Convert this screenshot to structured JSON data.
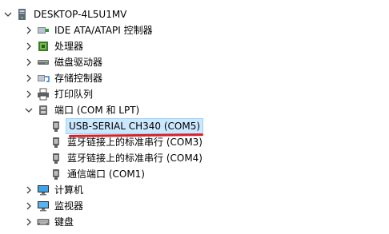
{
  "device_manager": {
    "root": {
      "label": "DESKTOP-4L5U1MV",
      "expanded": true,
      "icon": "computer-icon"
    },
    "items": [
      {
        "label": "IDE ATA/ATAPI 控制器",
        "expanded": false,
        "icon": "controller-icon"
      },
      {
        "label": "处理器",
        "expanded": false,
        "icon": "processor-icon"
      },
      {
        "label": "磁盘驱动器",
        "expanded": false,
        "icon": "disk-drive-icon"
      },
      {
        "label": "存储控制器",
        "expanded": false,
        "icon": "storage-controller-icon"
      },
      {
        "label": "打印队列",
        "expanded": false,
        "icon": "printer-icon"
      },
      {
        "label": "端口 (COM 和 LPT)",
        "expanded": true,
        "icon": "port-icon",
        "children": [
          {
            "label": "USB-SERIAL CH340 (COM5)",
            "selected": true,
            "icon": "serial-port-icon"
          },
          {
            "label": "蓝牙链接上的标准串行 (COM3)",
            "icon": "serial-port-icon"
          },
          {
            "label": "蓝牙链接上的标准串行 (COM4)",
            "icon": "serial-port-icon"
          },
          {
            "label": "通信端口 (COM1)",
            "icon": "serial-port-icon"
          }
        ]
      },
      {
        "label": "计算机",
        "expanded": false,
        "icon": "computer-monitor-icon"
      },
      {
        "label": "监视器",
        "expanded": false,
        "icon": "monitor-icon"
      },
      {
        "label": "键盘",
        "expanded": false,
        "icon": "keyboard-icon"
      }
    ]
  },
  "colors": {
    "selection_bg": "#cce8ff",
    "selection_border": "#99d1ff",
    "annotation_underline": "#d6222a",
    "chevron": "#404040"
  }
}
